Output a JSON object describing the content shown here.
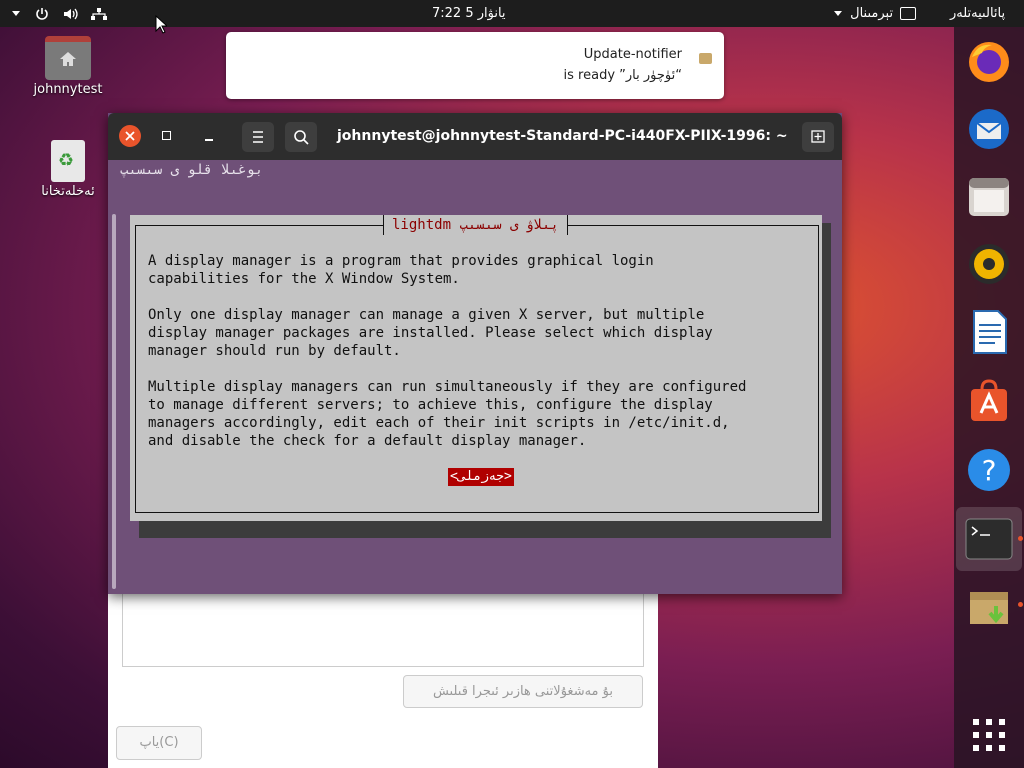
{
  "topbar": {
    "clock": "7:22  5 يانۋار",
    "terminal_menu": "تېرمىنال",
    "activities": "پائالىيەتلەر"
  },
  "desktop": {
    "home_label": "johnnytest",
    "trash_label": "ئەخلەتخانا"
  },
  "notification": {
    "title": "Update-notifier",
    "body": "is ready ”ئۈچۈر بار“"
  },
  "terminal": {
    "title": "johnnytest@johnnytest-Standard-PC-i440FX-PIIX-1996: ~",
    "bg_line": "بوغىلا قلو ى سىسىپ",
    "whiptail_title": "lightdm پىلاۋ ى سىسىپ",
    "whiptail_text": "A display manager is a program that provides graphical login\ncapabilities for the X Window System.\n\nOnly one display manager can manage a given X server, but multiple\ndisplay manager packages are installed. Please select which display\nmanager should run by default.\n\nMultiple display managers can run simultaneously if they are configured\nto manage different servers; to achieve this, configure the display\nmanagers accordingly, edit each of their init scripts in /etc/init.d,\nand disable the check for a default display manager.",
    "ok_button": "<جەزملى>"
  },
  "bg_dialog": {
    "run_button": "بۇ مەشغۇلاتنى ھازىر ئىجرا قىلىش",
    "close_button": "ياپ(C)"
  },
  "dock": {
    "items": [
      "firefox-icon",
      "thunderbird-icon",
      "files-icon",
      "rhythmbox-icon",
      "libreoffice-writer-icon",
      "ubuntu-software-icon",
      "help-icon",
      "terminal-icon",
      "software-updater-icon",
      "show-apps-icon"
    ]
  }
}
